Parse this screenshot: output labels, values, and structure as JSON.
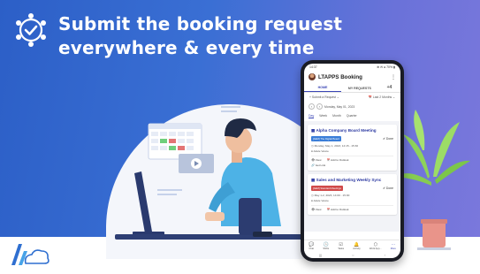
{
  "headline": {
    "line1": "Submit the booking request",
    "line2": "everywhere & every time"
  },
  "colors": {
    "banner_start": "#2c5fc7",
    "banner_end": "#7b78dc",
    "accent": "#3b46b5",
    "tag_blue": "#3b7ed8",
    "tag_red": "#d04a4a"
  },
  "phone": {
    "status_time": "14:37",
    "status_icons": "⊕ ✉ ● 70% ▮",
    "app_title": "LTAPPS Booking",
    "tabs": [
      {
        "label": "HOME"
      },
      {
        "label": "MY REQUESTS"
      },
      {
        "label": "+4"
      }
    ],
    "toolbar": {
      "submit_label": "+ Submit a Request ⌄",
      "range_label": "📅 Last 2 Months ⌄"
    },
    "date_label": "Monday, May 01, 2023",
    "views": [
      "Day",
      "Week",
      "Month",
      "Quarter"
    ],
    "cards": [
      {
        "title": "Alpha Company Board Meeting",
        "tag": "[AEM] The Digital Board",
        "status": "✔ Done",
        "when": "Monday, May 1, 2023, 14:15 - 15:30",
        "who": "Adele Vance",
        "actions": [
          "👁 View",
          "📅 Add to Outlook"
        ],
        "extra": "🔗 Get Link"
      },
      {
        "title": "Sales and Marketing Weekly Sync",
        "tag": "[AEM] Standard Meetings",
        "status": "✔ Done",
        "when": "May 1-2, 2023, 14:00 - 15:00",
        "who": "Adele Vance",
        "actions": [
          "👁 View",
          "📅 Add to Outlook"
        ],
        "extra": ""
      }
    ],
    "bottom_nav": [
      {
        "icon": "chat-icon",
        "glyph": "💬",
        "label": "Chat"
      },
      {
        "icon": "shifts-icon",
        "glyph": "🕓",
        "label": "Shifts"
      },
      {
        "icon": "tasks-icon",
        "glyph": "☑",
        "label": "Tasks"
      },
      {
        "icon": "activity-icon",
        "glyph": "🔔",
        "label": "Activity"
      },
      {
        "icon": "workapp-icon",
        "glyph": "⬡",
        "label": "Work App..."
      },
      {
        "icon": "more-icon",
        "glyph": "⋯",
        "label": "More"
      }
    ],
    "home_bar": [
      "|||",
      "○",
      "‹"
    ]
  }
}
